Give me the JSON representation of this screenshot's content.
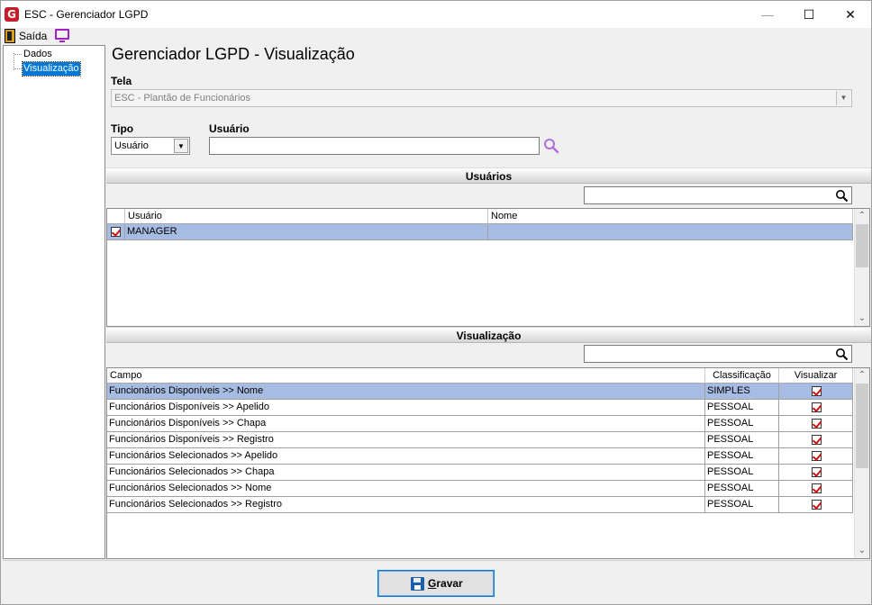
{
  "window": {
    "title": "ESC - Gerenciador LGPD",
    "logo_letter": "G",
    "minimize": "—",
    "maximize": "☐",
    "close": "✕"
  },
  "menu": {
    "exit_label": "Saída"
  },
  "tree": {
    "items": [
      {
        "label": "Dados"
      },
      {
        "label": "Visualização",
        "selected": true
      }
    ]
  },
  "page": {
    "title": "Gerenciador LGPD - Visualização"
  },
  "form": {
    "tela_label": "Tela",
    "tela_value": "ESC - Plantão de Funcionários",
    "tipo_label": "Tipo",
    "tipo_value": "Usuário",
    "usuario_label": "Usuário",
    "usuario_value": ""
  },
  "users_section": {
    "title": "Usuários",
    "filter_value": "",
    "columns": [
      "Usuário",
      "Nome"
    ],
    "rows": [
      {
        "checked": true,
        "usuario": "MANAGER",
        "nome": ""
      }
    ]
  },
  "view_section": {
    "title": "Visualização",
    "filter_value": "",
    "columns": [
      "Campo",
      "Classificação",
      "Visualizar"
    ],
    "rows": [
      {
        "campo": "Funcionários Disponíveis  >> Nome",
        "classificacao": "SIMPLES",
        "visualizar": true
      },
      {
        "campo": "Funcionários Disponíveis >> Apelido",
        "classificacao": "PESSOAL",
        "visualizar": true
      },
      {
        "campo": "Funcionários Disponíveis >> Chapa",
        "classificacao": "PESSOAL",
        "visualizar": true
      },
      {
        "campo": "Funcionários Disponíveis >> Registro",
        "classificacao": "PESSOAL",
        "visualizar": true
      },
      {
        "campo": "Funcionários Selecionados >> Apelido",
        "classificacao": "PESSOAL",
        "visualizar": true
      },
      {
        "campo": "Funcionários Selecionados >> Chapa",
        "classificacao": "PESSOAL",
        "visualizar": true
      },
      {
        "campo": "Funcionários Selecionados >> Nome",
        "classificacao": "PESSOAL",
        "visualizar": true
      },
      {
        "campo": "Funcionários Selecionados >> Registro",
        "classificacao": "PESSOAL",
        "visualizar": true
      }
    ]
  },
  "actions": {
    "save_label": "Gravar"
  },
  "icons": {
    "app": "app-logo-icon",
    "exit": "exit-door-icon",
    "monitor": "monitor-icon",
    "search": "search-icon",
    "save": "floppy-disk-icon"
  },
  "colors": {
    "selection": "#a7bce3",
    "tree_selection": "#0078d7",
    "check": "#d01010",
    "accent_purple": "#a020c0",
    "brand_red": "#c41e2a"
  }
}
